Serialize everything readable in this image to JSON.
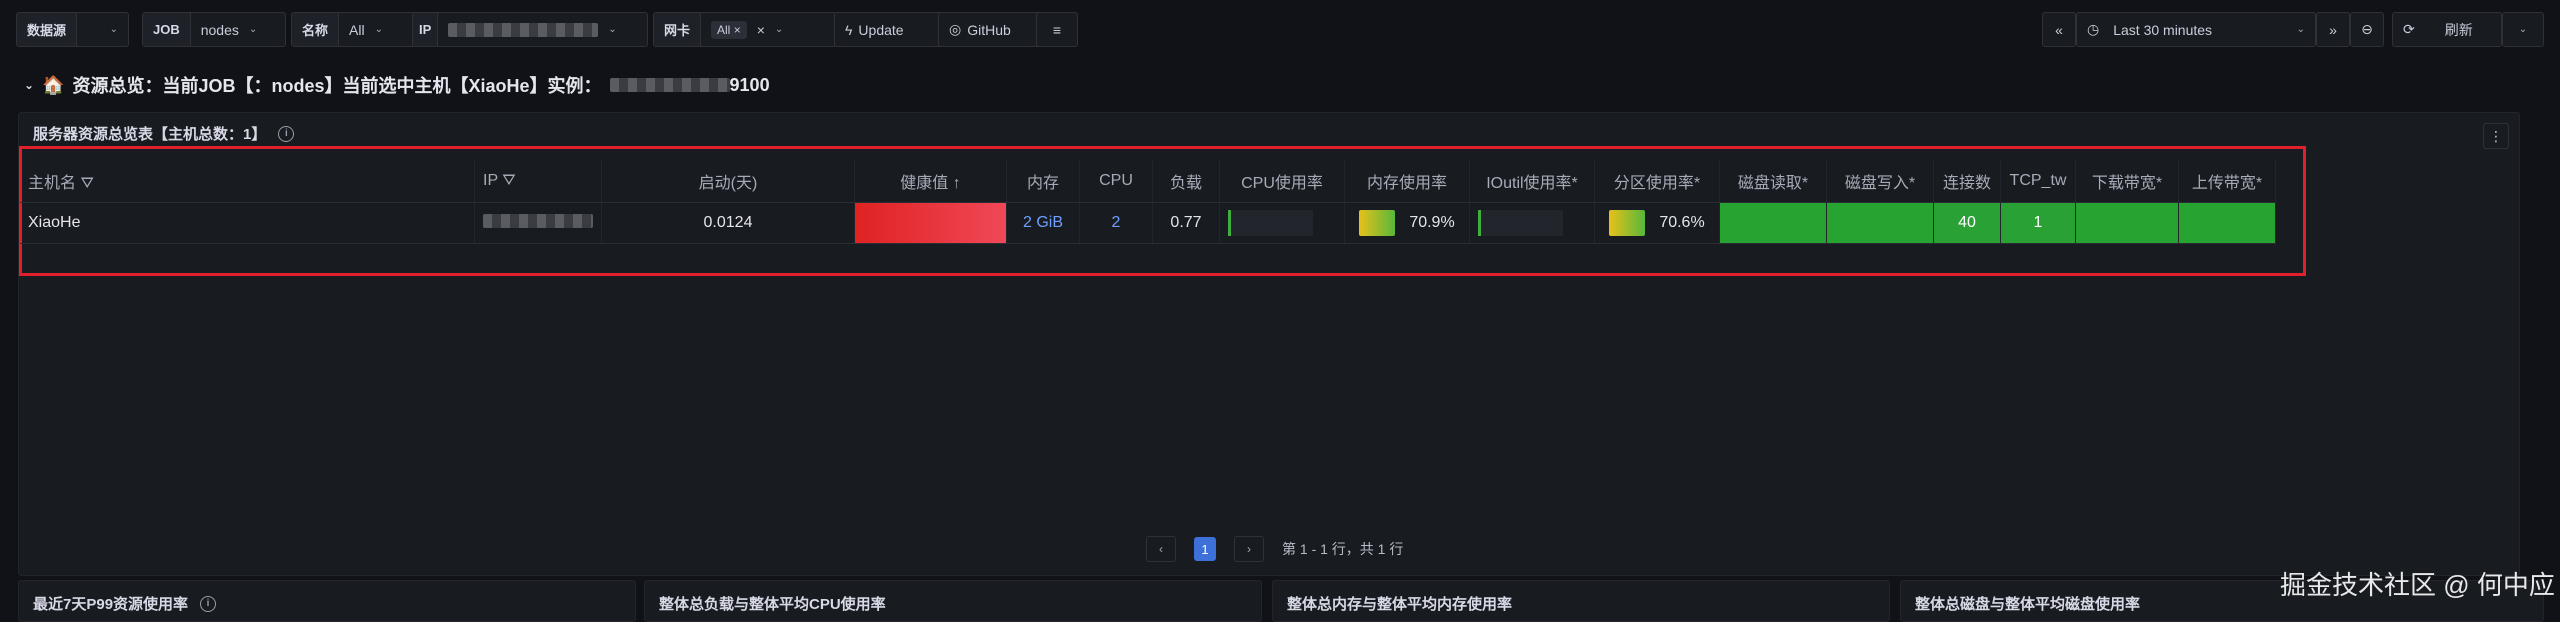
{
  "toolbar": {
    "datasource_label": "数据源",
    "job_label": "JOB",
    "job_value": "nodes",
    "name_label": "名称",
    "name_value": "All",
    "ip_label": "IP",
    "nic_label": "网卡",
    "nic_value": "All",
    "update_label": "Update",
    "github_label": "GitHub",
    "time_range": "Last 30 minutes",
    "refresh_label": "刷新"
  },
  "section": {
    "title": "资源总览：当前JOB【：nodes】当前选中主机【XiaoHe】实例：",
    "instance_suffix": "9100"
  },
  "panel": {
    "title": "服务器资源总览表【主机总数：1】"
  },
  "table": {
    "headers": {
      "host": "主机名",
      "ip": "IP",
      "uptime": "启动(天)",
      "health": "健康值",
      "mem": "内存",
      "cpu": "CPU",
      "load": "负载",
      "cpu_usage": "CPU使用率",
      "mem_usage": "内存使用率",
      "ioutil": "IOutil使用率*",
      "part_usage": "分区使用率*",
      "disk_read": "磁盘读取*",
      "disk_write": "磁盘写入*",
      "conn": "连接数",
      "tcp_tw": "TCP_tw",
      "download": "下载带宽*",
      "upload": "上传带宽*"
    },
    "row": {
      "host": "XiaoHe",
      "uptime": "0.0124",
      "mem": "2 GiB",
      "cpu": "2",
      "load": "0.77",
      "mem_usage": "70.9%",
      "part_usage": "70.6%",
      "conn": "40",
      "tcp_tw": "1"
    }
  },
  "pager": {
    "page": "1",
    "summary": "第 1 - 1 行，共 1 行"
  },
  "bottom": {
    "p1": "最近7天P99资源使用率",
    "p2": "整体总负载与整体平均CPU使用率",
    "p3": "整体总内存与整体平均内存使用率",
    "p4": "整体总磁盘与整体平均磁盘使用率"
  },
  "watermark": "掘金技术社区 @ 何中应",
  "colors": {
    "bg": "#111217",
    "panel": "#181b1f",
    "highlight": "#e0202a",
    "green": "#27a332",
    "link": "#6e9fff"
  }
}
